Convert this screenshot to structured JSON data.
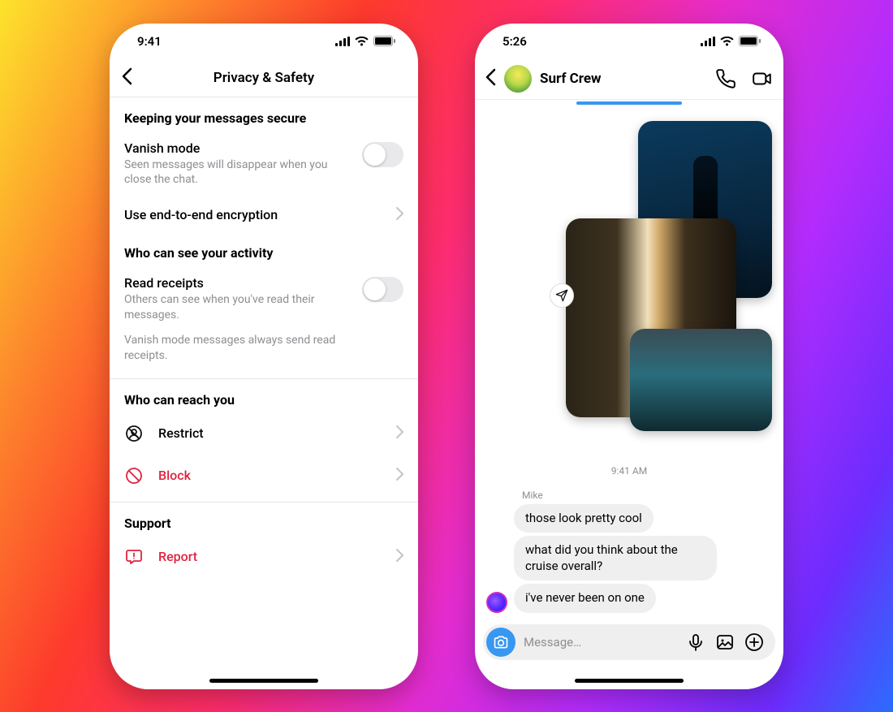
{
  "colors": {
    "danger": "#E0223E",
    "ig_blue": "#3897F0"
  },
  "left": {
    "status_time": "9:41",
    "nav_title": "Privacy & Safety",
    "sections": [
      {
        "header": "Keeping your messages secure",
        "rows": [
          {
            "title": "Vanish mode",
            "desc": "Seen messages will disappear when you close the chat.",
            "type": "toggle",
            "on": false
          },
          {
            "title": "Use end-to-end encryption",
            "type": "chevron"
          }
        ]
      },
      {
        "header": "Who can see your activity",
        "rows": [
          {
            "title": "Read receipts",
            "desc": "Others can see when you've read their messages.",
            "extra": "Vanish mode messages always send read receipts.",
            "type": "toggle",
            "on": false
          }
        ]
      },
      {
        "header": "Who can reach you",
        "items": [
          {
            "icon": "restrict-icon",
            "label": "Restrict",
            "danger": false
          },
          {
            "icon": "block-icon",
            "label": "Block",
            "danger": true
          }
        ]
      },
      {
        "header": "Support",
        "items": [
          {
            "icon": "report-icon",
            "label": "Report",
            "danger": true
          }
        ]
      }
    ]
  },
  "right": {
    "status_time": "5:26",
    "chat_title": "Surf Crew",
    "timestamp": "9:41 AM",
    "sender": "Mike",
    "messages": [
      "those look pretty cool",
      "what did you think about the cruise overall?",
      "i've never been on one"
    ],
    "composer_placeholder": "Message…"
  }
}
